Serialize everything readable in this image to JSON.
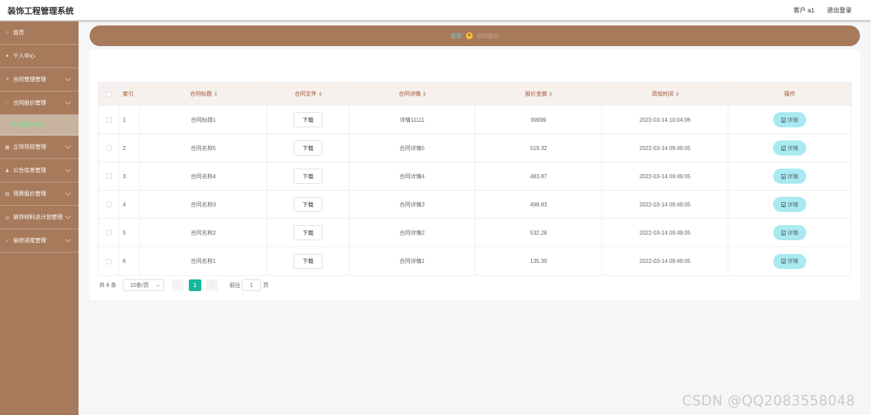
{
  "header": {
    "app_title": "装饰工程管理系统",
    "user_info": "客户 a1",
    "logout_label": "退出登录"
  },
  "sidebar": {
    "items": [
      {
        "label": "首页",
        "icon": "home-icon"
      },
      {
        "label": "个人中心",
        "icon": "user-icon"
      },
      {
        "label": "合同管理管理",
        "icon": "contract-icon"
      },
      {
        "label": "合同报价管理",
        "icon": "quote-icon"
      },
      {
        "label": "立项项目管理",
        "icon": "project-icon"
      },
      {
        "label": "公告信息管理",
        "icon": "notice-icon"
      },
      {
        "label": "预算报价管理",
        "icon": "budget-icon"
      },
      {
        "label": "装饰材料总计划管理",
        "icon": "material-icon"
      },
      {
        "label": "装修进度管理",
        "icon": "progress-icon"
      }
    ],
    "active_sub_item": "合同报价管理"
  },
  "breadcrumb": {
    "home": "首页",
    "current": "合同报价"
  },
  "table": {
    "headers": [
      "索引",
      "合同标题",
      "合同文件",
      "合同详情",
      "报价金额",
      "添加时间",
      "操作"
    ],
    "download_label": "下载",
    "detail_label": "详情",
    "rows": [
      {
        "index": "1",
        "title": "合同标题1",
        "detail": "详情11111",
        "amount": "99999",
        "time": "2022-03-14 10:04:06"
      },
      {
        "index": "2",
        "title": "合同名称5",
        "detail": "合同详情5",
        "amount": "519.32",
        "time": "2022-03-14 09:49:05"
      },
      {
        "index": "3",
        "title": "合同名称4",
        "detail": "合同详情4",
        "amount": "483.87",
        "time": "2022-03-14 09:49:05"
      },
      {
        "index": "4",
        "title": "合同名称3",
        "detail": "合同详情3",
        "amount": "498.83",
        "time": "2022-03-14 09:49:05"
      },
      {
        "index": "5",
        "title": "合同名称2",
        "detail": "合同详情2",
        "amount": "532.28",
        "time": "2022-03-14 09:49:05"
      },
      {
        "index": "6",
        "title": "合同名称1",
        "detail": "合同详情1",
        "amount": "135.39",
        "time": "2022-03-14 09:49:05"
      }
    ]
  },
  "pagination": {
    "total": "共 6 条",
    "page_size": "10条/页",
    "current_page": "1",
    "goto_label": "前往",
    "goto_value": "1",
    "page_suffix": "页"
  },
  "watermark": "CSDN @QQ2083558048"
}
